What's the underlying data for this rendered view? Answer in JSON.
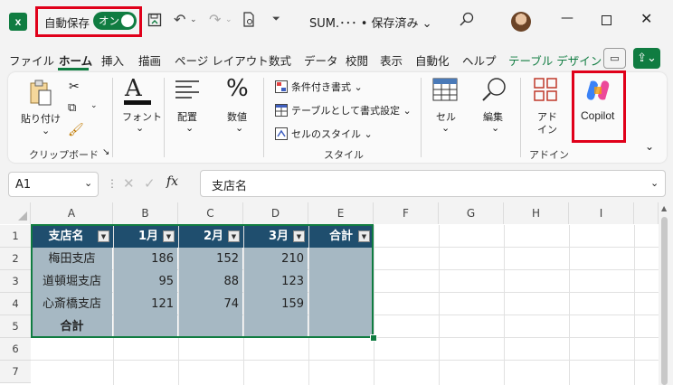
{
  "titlebar": {
    "autosave_label": "自動保存",
    "autosave_toggle": "オン",
    "filename": "SUM.･･･ • 保存済み ⌄"
  },
  "tabs": [
    "ファイル",
    "ホーム",
    "挿入",
    "描画",
    "ページ レイアウト",
    "数式",
    "データ",
    "校閲",
    "表示",
    "自動化",
    "ヘルプ",
    "テーブル デザイン"
  ],
  "ribbon": {
    "clipboard": {
      "paste": "貼り付け",
      "group": "クリップボード"
    },
    "font": {
      "label": "フォント"
    },
    "alignment": {
      "label": "配置"
    },
    "number": {
      "label": "数値"
    },
    "styles": {
      "conditional": "条件付き書式 ⌄",
      "table_format": "テーブルとして書式設定 ⌄",
      "cell_style": "セルのスタイル ⌄",
      "group": "スタイル"
    },
    "cells": {
      "label": "セル"
    },
    "editing": {
      "label": "編集"
    },
    "addin": {
      "label1": "アド",
      "label2": "イン",
      "group": "アドイン"
    },
    "copilot": {
      "label": "Copilot"
    }
  },
  "formula_bar": {
    "name_box": "A1",
    "fx": "fx",
    "value": "支店名"
  },
  "grid": {
    "columns": [
      "A",
      "B",
      "C",
      "D",
      "E",
      "F",
      "G",
      "H",
      "I"
    ],
    "rows": [
      "1",
      "2",
      "3",
      "4",
      "5",
      "6",
      "7"
    ],
    "table_header": [
      "支店名",
      "1月",
      "2月",
      "3月",
      "合計"
    ],
    "table_rows": [
      [
        "梅田支店",
        "186",
        "152",
        "210",
        ""
      ],
      [
        "道頓堀支店",
        "95",
        "88",
        "123",
        ""
      ],
      [
        "心斎橋支店",
        "121",
        "74",
        "159",
        ""
      ],
      [
        "合計",
        "",
        "",
        "",
        ""
      ]
    ]
  },
  "colors": {
    "accent": "#107c41",
    "highlight_border": "#e0001a",
    "table_header": "#1f4e6e",
    "table_body": "#a6b8c3"
  }
}
